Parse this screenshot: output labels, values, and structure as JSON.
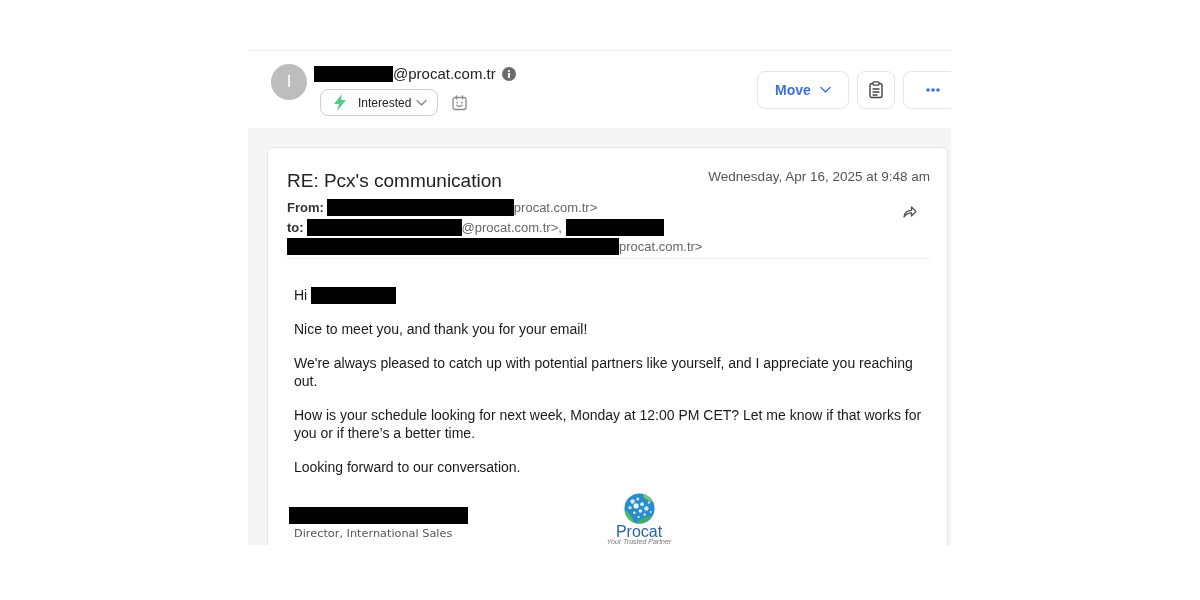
{
  "header": {
    "avatar": {
      "initial": "I"
    },
    "sender": [
      {
        "kind": "redacted"
      },
      {
        "kind": "text",
        "text": "@procat.com.tr"
      }
    ],
    "tag": {
      "label": "Interested"
    },
    "actions": [
      {
        "kind": "menu",
        "label": "Move"
      },
      {
        "kind": "notes"
      },
      {
        "kind": "more"
      }
    ]
  },
  "message": {
    "subject": "RE: Pcx's communication",
    "date": "Wednesday, Apr 16, 2025 at 9:48 am",
    "from": {
      "label": "From:",
      "parts": [
        {
          "kind": "redacted"
        },
        {
          "kind": "text",
          "text": "procat.com.tr>"
        }
      ]
    },
    "to": {
      "label": "to:",
      "parts": [
        {
          "kind": "redacted"
        },
        {
          "kind": "text",
          "text": "@procat.com.tr>,"
        },
        {
          "kind": "redacted"
        },
        {
          "kind": "redacted"
        },
        {
          "kind": "text",
          "text": "procat.com.tr>"
        }
      ]
    },
    "greeting": [
      {
        "kind": "text",
        "text": "Hi"
      },
      {
        "kind": "redacted"
      }
    ],
    "paragraphs": [
      "Nice to meet you, and thank you for your email!",
      "We're always pleased to catch up with potential partners like yourself, and I appreciate you reaching out.",
      "How is your schedule looking for next week, Monday at 12:00 PM CET? Let me know if that works for you or if there’s a better time.",
      "Looking forward to our conversation."
    ],
    "signature": {
      "parts": [
        {
          "kind": "redacted"
        }
      ],
      "title": "Director, International Sales"
    },
    "logo": {
      "name": "Procat",
      "tagline": "Your Trusted Partner"
    }
  }
}
